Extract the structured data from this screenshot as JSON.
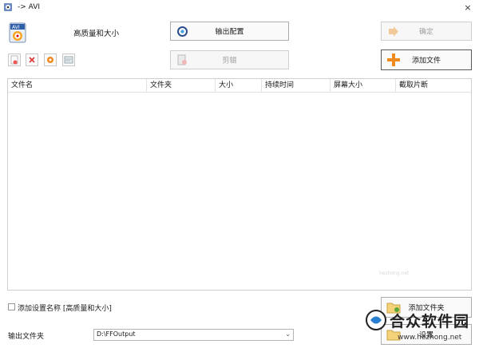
{
  "window": {
    "title": "-> AVI",
    "close_glyph": "×"
  },
  "header": {
    "preset_label": "高质量和大小"
  },
  "buttons": {
    "output_config": "输出配置",
    "confirm": "确定",
    "clip": "剪辑",
    "add_file": "添加文件",
    "add_folder": "添加文件夹",
    "settings": "设置"
  },
  "toolbar_icons": [
    "add-doc-icon",
    "remove-icon",
    "clear-icon",
    "media-info-icon"
  ],
  "table": {
    "columns": [
      "文件名",
      "文件夹",
      "大小",
      "持续时间",
      "屏幕大小",
      "截取片断"
    ],
    "rows": []
  },
  "bottom": {
    "add_name_label": "添加设置名称 [高质量和大小]",
    "add_name_checked": false,
    "output_folder_label": "输出文件夹",
    "output_folder_value": "D:\\FFOutput"
  },
  "watermark": {
    "brand": "合众软件园",
    "url": "www.hezhong.net",
    "faint_mid": "hezhong.net"
  },
  "colors": {
    "accent_orange": "#f08a1c",
    "disabled_text": "#a0a0a0",
    "border": "#adadad"
  }
}
